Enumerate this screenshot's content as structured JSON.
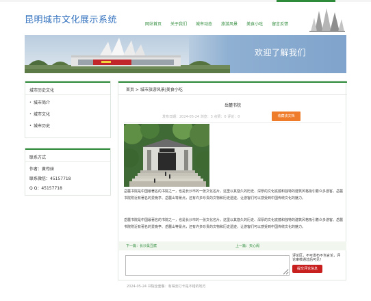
{
  "header": {
    "site_title": "昆明城市文化展示系统",
    "nav": [
      "网站首页",
      "关于我们",
      "城市动态",
      "旅游风景",
      "美食小吃",
      "留言反馈"
    ]
  },
  "banner": {
    "text": "欢迎了解我们"
  },
  "sidebar": {
    "history": {
      "title": "城市历史文化",
      "items": [
        "城市简介",
        "城市文化",
        "城市历史"
      ]
    },
    "contact": {
      "title": "联系方式",
      "lines": [
        "作者：黄苟妹",
        "联系微信：45157718",
        "Q Q：45157718"
      ]
    }
  },
  "main": {
    "breadcrumb": "首页 > 城市旅游风景|美食小吃",
    "article": {
      "title": "岳麓书院",
      "meta": "发布日期：2024-05-24    浏览：3    点赞：0    评论：0",
      "favorite_label": "收藏该文档",
      "paragraphs": [
        "岳麓书院是中国最著名的书院之一，也是长沙市的一张文化名片。这里以其悠久的历史、深厚的文化底蕴和独特的建筑风格吸引着众多游客。岳麓书院附近有著名的爱晚亭、岳麓山等景点，还有许多珍贵的文物和历史遗迹，让游客们可以感受到中国传统文化的魅力。",
        "岳麓书院是中国最著名的书院之一，也是长沙市的一张文化名片。这里以其悠久的历史、深厚的文化底蕴和独特的建筑风格吸引着众多游客。岳麓书院附近有著名的爱晚亭、岳麓山等景点，还有许多珍贵的文物和历史遗迹，让游客们可以感受到中国传统文化的魅力。"
      ]
    },
    "prev": "下一篇：长沙臭豆腐",
    "next": "上一篇：天心阁",
    "comment": {
      "hint": "评论区，不可发布不当言论，评论审核通过后可见！",
      "submit_label": "提交评论信息"
    },
    "footer_note": "2024-05-24 书院全套餐：有得去打卡是不错的地方"
  },
  "colors": {
    "brand_green": "#2e8b3a",
    "title_blue": "#2f6fbd",
    "favorite_orange": "#ef7c2a",
    "submit_red": "#c8201f"
  }
}
